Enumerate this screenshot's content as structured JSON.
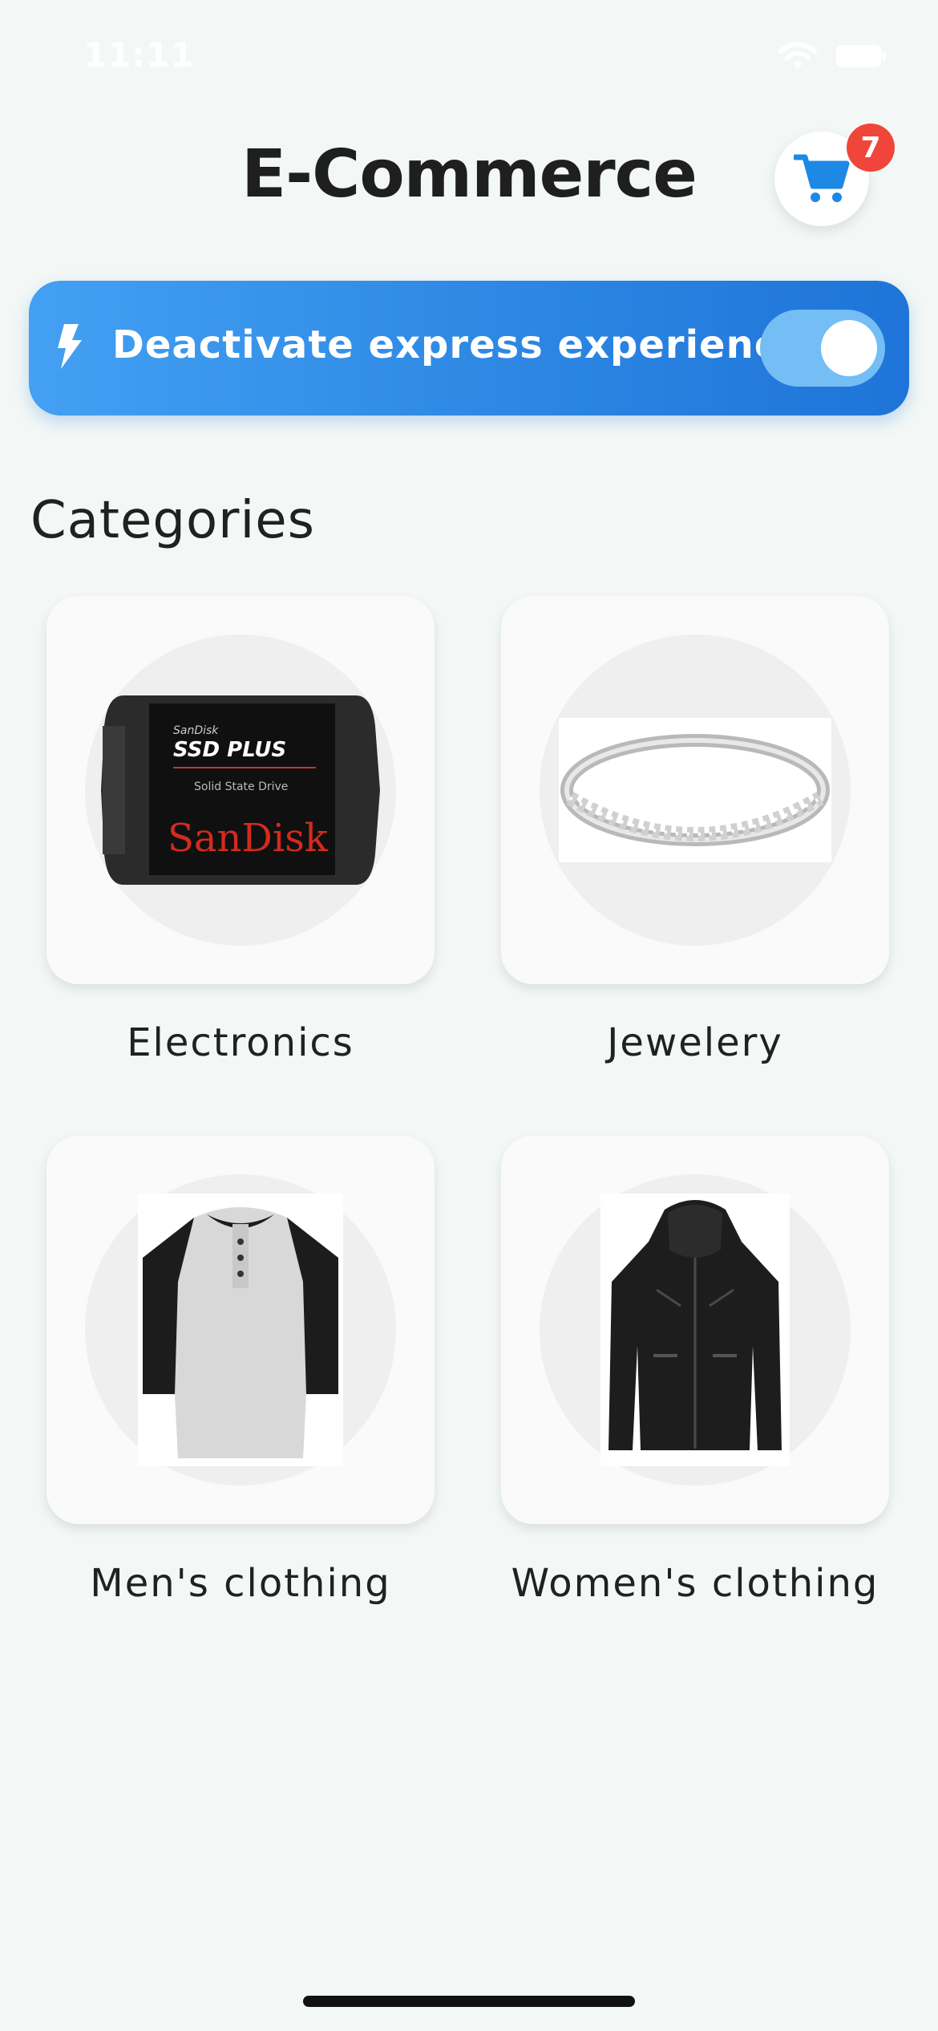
{
  "status_bar": {
    "time": "11:11"
  },
  "header": {
    "title": "E-Commerce",
    "cart_count": "7"
  },
  "express": {
    "label": "Deactivate express experience",
    "enabled": true
  },
  "categories_section": {
    "title": "Categories"
  },
  "categories": [
    {
      "label": "Electronics",
      "image": "ssd-drive"
    },
    {
      "label": "Jewelery",
      "image": "ring"
    },
    {
      "label": "Men's clothing",
      "image": "shirt"
    },
    {
      "label": "Women's clothing",
      "image": "jacket"
    }
  ],
  "colors": {
    "background": "#f3f8f6",
    "accent": "#2d87e3",
    "badge": "#f0453a",
    "cart_icon": "#1e88e5"
  }
}
